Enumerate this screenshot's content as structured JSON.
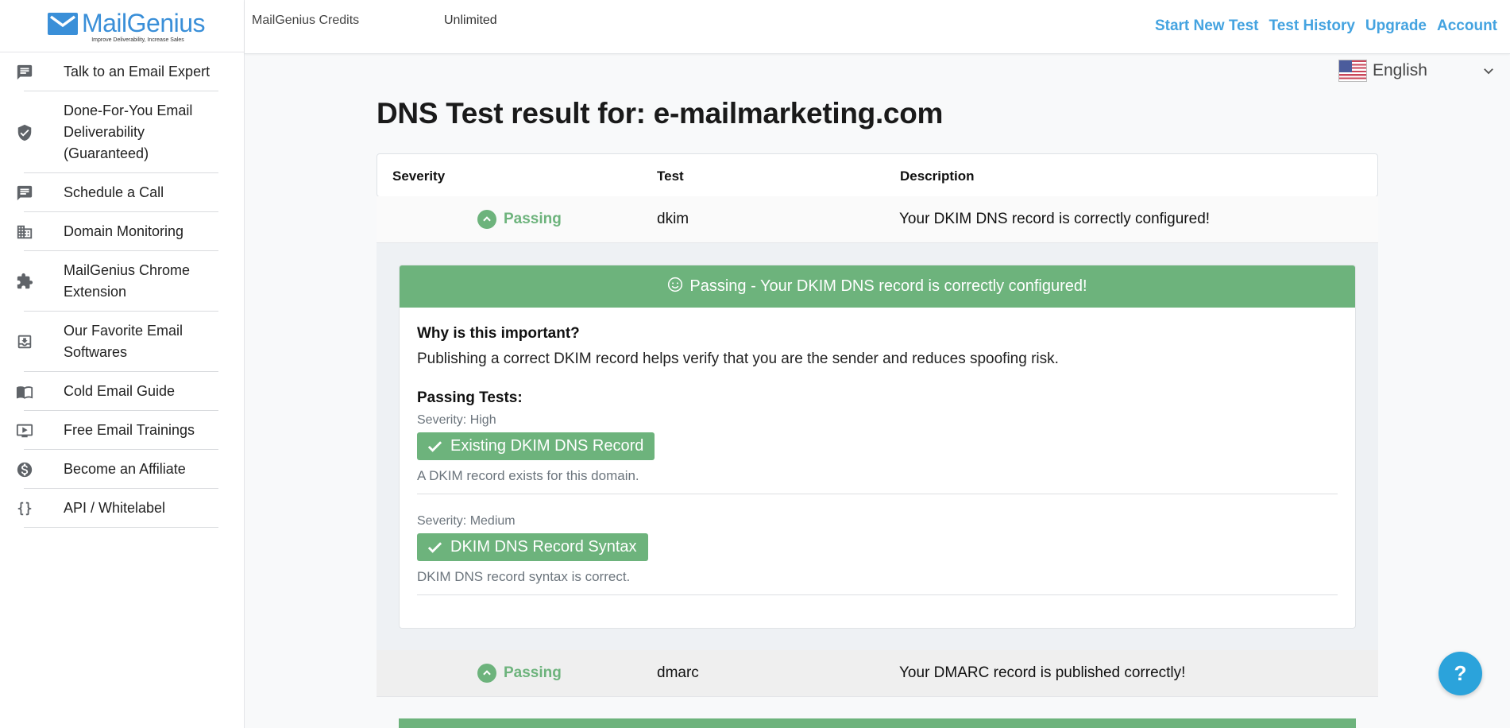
{
  "logo": {
    "name": "MailGenius",
    "tagline": "Improve Deliverability, Increase Sales"
  },
  "sidebar": {
    "items": [
      {
        "label": "Talk to an Email Expert",
        "icon": "chat-icon"
      },
      {
        "label": "Done-For-You Email Deliverability (Guaranteed)",
        "icon": "shield-check-icon"
      },
      {
        "label": "Schedule a Call",
        "icon": "chat-icon"
      },
      {
        "label": "Domain Monitoring",
        "icon": "building-icon"
      },
      {
        "label": "MailGenius Chrome Extension",
        "icon": "puzzle-icon"
      },
      {
        "label": "Our Favorite Email Softwares",
        "icon": "download-box-icon"
      },
      {
        "label": "Cold Email Guide",
        "icon": "book-icon"
      },
      {
        "label": "Free Email Trainings",
        "icon": "video-icon"
      },
      {
        "label": "Become an Affiliate",
        "icon": "dollar-icon"
      },
      {
        "label": "API / Whitelabel",
        "icon": "braces-icon"
      }
    ]
  },
  "header": {
    "credits_label": "MailGenius Credits",
    "credits_value": "Unlimited",
    "links": [
      "Start New Test",
      "Test History",
      "Upgrade",
      "Account"
    ]
  },
  "language": {
    "selected": "English"
  },
  "page": {
    "title": "DNS Test result for: e-mailmarketing.com"
  },
  "table": {
    "headers": {
      "severity": "Severity",
      "test": "Test",
      "description": "Description"
    },
    "rows": [
      {
        "severity": "Passing",
        "test": "dkim",
        "description": "Your DKIM DNS record is correctly configured!"
      },
      {
        "severity": "Passing",
        "test": "dmarc",
        "description": "Your DMARC record is published correctly!"
      }
    ]
  },
  "detail": {
    "banner": "Passing - Your DKIM DNS record is correctly configured!",
    "why_title": "Why is this important?",
    "why_text": "Publishing a correct DKIM record helps verify that you are the sender and reduces spoofing risk.",
    "passing_title": "Passing Tests:",
    "checks": [
      {
        "severity": "Severity: High",
        "name": "Existing DKIM DNS Record",
        "description": "A DKIM record exists for this domain."
      },
      {
        "severity": "Severity: Medium",
        "name": "DKIM DNS Record Syntax",
        "description": "DKIM DNS record syntax is correct."
      }
    ]
  },
  "help": {
    "label": "?"
  },
  "colors": {
    "accent_blue": "#44a3e0",
    "passing_green": "#6db37c",
    "help_blue": "#2ba3db"
  }
}
